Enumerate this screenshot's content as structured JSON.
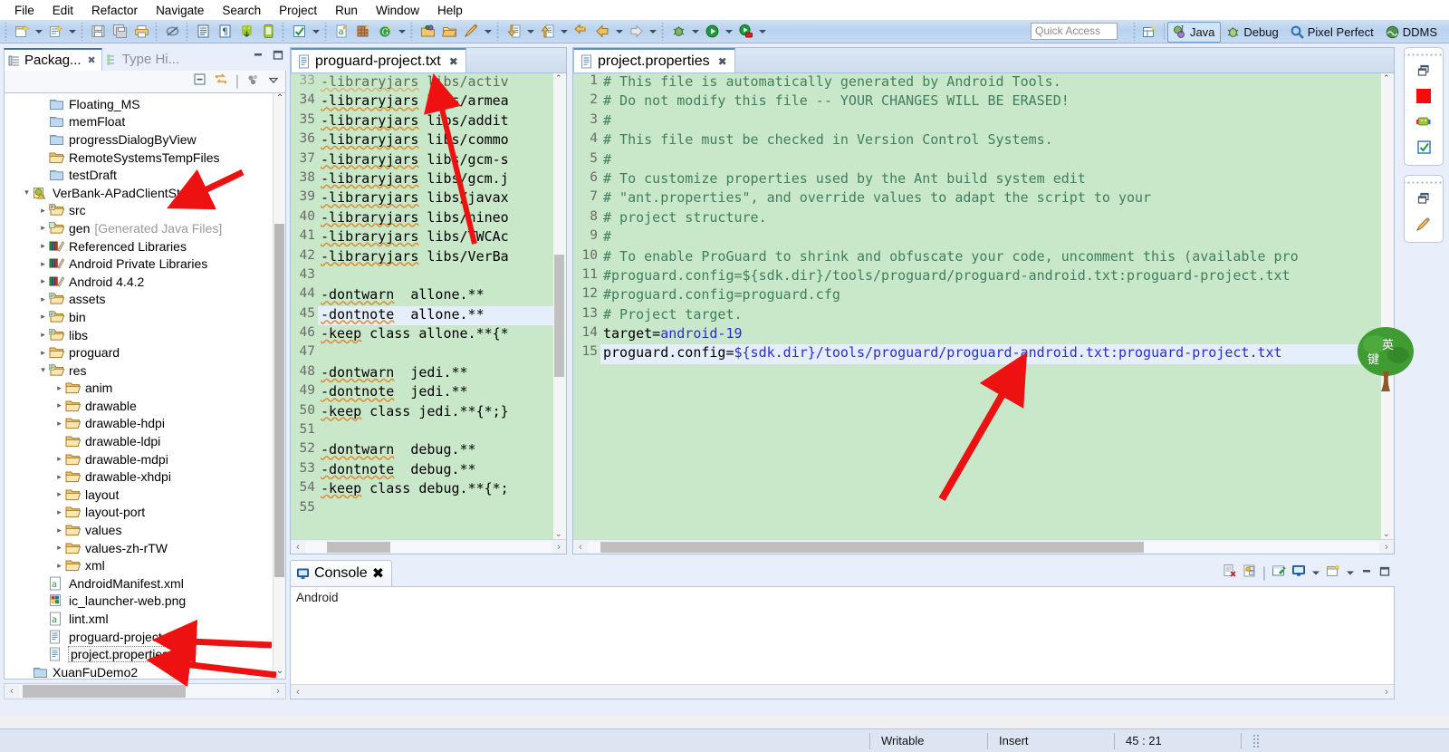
{
  "menubar": {
    "items": [
      "File",
      "Edit",
      "Refactor",
      "Navigate",
      "Search",
      "Project",
      "Run",
      "Window",
      "Help"
    ]
  },
  "toolbar": {
    "quick_access_placeholder": "Quick Access",
    "perspectives": [
      {
        "label": "Java",
        "icon": "java-perspective-icon",
        "active": true
      },
      {
        "label": "Debug",
        "icon": "debug-perspective-icon",
        "active": false
      },
      {
        "label": "Pixel Perfect",
        "icon": "pixel-perfect-icon",
        "active": false
      },
      {
        "label": "DDMS",
        "icon": "ddms-icon",
        "active": false
      }
    ],
    "buttons": [
      "new-wizard-icon",
      "new-java-class-icon",
      "save-icon",
      "save-all-icon",
      "print-icon",
      "toggle-breakpoint-icon",
      "open-task-icon",
      "show-whitespace-icon",
      "android-sdk-manager-icon",
      "android-avd-manager-icon",
      "check-icon",
      "new-android-xml-icon",
      "new-android-project-icon",
      "gwt-icon",
      "open-type-icon",
      "open-resource-icon",
      "pencil-icon",
      "debug-icon",
      "run-icon",
      "run-external-icon",
      "next-annotation-icon",
      "previous-annotation-icon",
      "last-edit-icon",
      "back-icon",
      "forward-icon"
    ]
  },
  "package_explorer": {
    "tabs": [
      {
        "label": "Packag...",
        "icon": "package-explorer-icon",
        "active": true
      },
      {
        "label": "Type Hi...",
        "icon": "type-hierarchy-icon",
        "active": false
      }
    ],
    "view_actions": [
      "collapse-all-icon",
      "link-with-editor-icon",
      "focus-icon",
      "view-menu-icon"
    ],
    "tree": [
      {
        "indent": 1,
        "twisty": "",
        "icon": "folder-closed-icon",
        "label": "Floating_MS"
      },
      {
        "indent": 1,
        "twisty": "",
        "icon": "folder-closed-icon",
        "label": "memFloat"
      },
      {
        "indent": 1,
        "twisty": "",
        "icon": "folder-closed-icon",
        "label": "progressDialogByView"
      },
      {
        "indent": 1,
        "twisty": "",
        "icon": "folder-open-icon",
        "label": "RemoteSystemsTempFiles"
      },
      {
        "indent": 1,
        "twisty": "",
        "icon": "folder-closed-icon",
        "label": "testDraft"
      },
      {
        "indent": 0,
        "twisty": "▾",
        "icon": "android-project-icon",
        "label": "VerBank-APadClientStation"
      },
      {
        "indent": 1,
        "twisty": "▸",
        "icon": "source-folder-icon",
        "label": "src"
      },
      {
        "indent": 1,
        "twisty": "▸",
        "icon": "gen-folder-icon",
        "label": "gen",
        "dim": "[Generated Java Files]"
      },
      {
        "indent": 1,
        "twisty": "▸",
        "icon": "library-icon",
        "label": "Referenced Libraries"
      },
      {
        "indent": 1,
        "twisty": "▸",
        "icon": "library-icon",
        "label": "Android Private Libraries"
      },
      {
        "indent": 1,
        "twisty": "▸",
        "icon": "library-icon",
        "label": "Android 4.4.2"
      },
      {
        "indent": 1,
        "twisty": "▸",
        "icon": "res-folder-icon",
        "label": "assets"
      },
      {
        "indent": 1,
        "twisty": "▸",
        "icon": "res-folder-icon",
        "label": "bin"
      },
      {
        "indent": 1,
        "twisty": "▸",
        "icon": "res-folder-icon",
        "label": "libs"
      },
      {
        "indent": 1,
        "twisty": "▸",
        "icon": "folder-open-icon",
        "label": "proguard"
      },
      {
        "indent": 1,
        "twisty": "▾",
        "icon": "res-folder-icon",
        "label": "res"
      },
      {
        "indent": 2,
        "twisty": "▸",
        "icon": "folder-open-icon",
        "label": "anim"
      },
      {
        "indent": 2,
        "twisty": "▸",
        "icon": "folder-open-icon",
        "label": "drawable"
      },
      {
        "indent": 2,
        "twisty": "▸",
        "icon": "folder-open-icon",
        "label": "drawable-hdpi"
      },
      {
        "indent": 2,
        "twisty": "",
        "icon": "folder-open-icon",
        "label": "drawable-ldpi"
      },
      {
        "indent": 2,
        "twisty": "▸",
        "icon": "folder-open-icon",
        "label": "drawable-mdpi"
      },
      {
        "indent": 2,
        "twisty": "▸",
        "icon": "folder-open-icon",
        "label": "drawable-xhdpi"
      },
      {
        "indent": 2,
        "twisty": "▸",
        "icon": "folder-open-icon",
        "label": "layout"
      },
      {
        "indent": 2,
        "twisty": "▸",
        "icon": "folder-open-icon",
        "label": "layout-port"
      },
      {
        "indent": 2,
        "twisty": "▸",
        "icon": "folder-open-icon",
        "label": "values"
      },
      {
        "indent": 2,
        "twisty": "▸",
        "icon": "folder-open-icon",
        "label": "values-zh-rTW"
      },
      {
        "indent": 2,
        "twisty": "▸",
        "icon": "folder-open-icon",
        "label": "xml"
      },
      {
        "indent": 1,
        "twisty": "",
        "icon": "android-xml-file-icon",
        "label": "AndroidManifest.xml"
      },
      {
        "indent": 1,
        "twisty": "",
        "icon": "png-image-icon",
        "label": "ic_launcher-web.png"
      },
      {
        "indent": 1,
        "twisty": "",
        "icon": "android-xml-file-icon",
        "label": "lint.xml"
      },
      {
        "indent": 1,
        "twisty": "",
        "icon": "text-file-icon",
        "label": "proguard-project.txt"
      },
      {
        "indent": 1,
        "twisty": "",
        "icon": "text-file-icon",
        "label": "project.properties",
        "selected": true
      },
      {
        "indent": 0,
        "twisty": "",
        "icon": "folder-closed-icon",
        "label": "XuanFuDemo2"
      }
    ]
  },
  "editor_left": {
    "tab": {
      "label": "proguard-project.txt",
      "icon": "text-file-icon",
      "close": "✖"
    },
    "lines": [
      {
        "n": "33",
        "text": "-libraryjars libs/activ",
        "clipped_top": true
      },
      {
        "n": "34",
        "text": "-libraryjars libs/armea"
      },
      {
        "n": "35",
        "text": "-libraryjars libs/addit"
      },
      {
        "n": "36",
        "text": "-libraryjars libs/commo"
      },
      {
        "n": "37",
        "text": "-libraryjars libs/gcm-s"
      },
      {
        "n": "38",
        "text": "-libraryjars libs/gcm.j"
      },
      {
        "n": "39",
        "text": "-libraryjars libs/javax"
      },
      {
        "n": "40",
        "text": "-libraryjars libs/nineo"
      },
      {
        "n": "41",
        "text": "-libraryjars libs/TWCAc"
      },
      {
        "n": "42",
        "text": "-libraryjars libs/VerBa"
      },
      {
        "n": "43",
        "text": ""
      },
      {
        "n": "44",
        "text": "-dontwarn  allone.**"
      },
      {
        "n": "45",
        "text": "-dontnote  allone.**",
        "caret": true
      },
      {
        "n": "46",
        "text": "-keep class allone.**{*"
      },
      {
        "n": "47",
        "text": ""
      },
      {
        "n": "48",
        "text": "-dontwarn  jedi.**"
      },
      {
        "n": "49",
        "text": "-dontnote  jedi.**"
      },
      {
        "n": "50",
        "text": "-keep class jedi.**{*;}"
      },
      {
        "n": "51",
        "text": ""
      },
      {
        "n": "52",
        "text": "-dontwarn  debug.**"
      },
      {
        "n": "53",
        "text": "-dontnote  debug.**"
      },
      {
        "n": "54",
        "text": "-keep class debug.**{*;"
      },
      {
        "n": "55",
        "text": ""
      }
    ]
  },
  "editor_right": {
    "tab": {
      "label": "project.properties",
      "icon": "text-file-icon",
      "close": "✖"
    },
    "lines": [
      {
        "n": "1",
        "text": "# This file is automatically generated by Android Tools.",
        "kind": "comment"
      },
      {
        "n": "2",
        "text": "# Do not modify this file -- YOUR CHANGES WILL BE ERASED!",
        "kind": "comment"
      },
      {
        "n": "3",
        "text": "#",
        "kind": "comment"
      },
      {
        "n": "4",
        "text": "# This file must be checked in Version Control Systems.",
        "kind": "comment"
      },
      {
        "n": "5",
        "text": "#",
        "kind": "comment"
      },
      {
        "n": "6",
        "text": "# To customize properties used by the Ant build system edit",
        "kind": "comment"
      },
      {
        "n": "7",
        "text": "# \"ant.properties\", and override values to adapt the script to your",
        "kind": "comment"
      },
      {
        "n": "8",
        "text": "# project structure.",
        "kind": "comment"
      },
      {
        "n": "9",
        "text": "#",
        "kind": "comment"
      },
      {
        "n": "10",
        "text": "# To enable ProGuard to shrink and obfuscate your code, uncomment this (available pro",
        "kind": "comment"
      },
      {
        "n": "11",
        "text": "#proguard.config=${sdk.dir}/tools/proguard/proguard-android.txt:proguard-project.txt",
        "kind": "comment"
      },
      {
        "n": "12",
        "text": "#proguard.config=proguard.cfg",
        "kind": "comment"
      },
      {
        "n": "13",
        "text": "# Project target.",
        "kind": "comment"
      },
      {
        "n": "14",
        "text": "target=android-19",
        "kind": "property",
        "key": "target=",
        "value": "android-19"
      },
      {
        "n": "15",
        "text": "proguard.config=${sdk.dir}/tools/proguard/proguard-android.txt:proguard-project.txt",
        "kind": "property",
        "key": "proguard.config=",
        "value": "${sdk.dir}/tools/proguard/proguard-android.txt:proguard-project.txt",
        "highlighted": true
      }
    ]
  },
  "console": {
    "tab": {
      "label": "Console",
      "icon": "console-icon",
      "close": "✖"
    },
    "stream_label": "Android",
    "tools": [
      "clear-console-icon",
      "scroll-lock-icon",
      "pin-console-icon",
      "display-selected-console-icon",
      "console-dropdown-icon",
      "open-console-icon",
      "open-console-dropdown-icon",
      "minimize-icon",
      "maximize-icon"
    ]
  },
  "fastview": {
    "groups": [
      {
        "items": [
          "restore-icon",
          "red-square-icon",
          "logcat-icon",
          "checkbox-icon"
        ]
      },
      {
        "items": [
          "restore-icon",
          "pencil-icon"
        ]
      }
    ]
  },
  "statusbar": {
    "writable": "Writable",
    "insert_mode": "Insert",
    "cursor_position": "45 : 21"
  },
  "watermark": {
    "line1": "英",
    "line2": "键"
  },
  "colors": {
    "editor_background": "#c9e7c9",
    "selection": "#e5eefb",
    "accent": "#2b2bd8",
    "comment": "#3f7f5f",
    "arrow": "#ee1111",
    "toolbar": "#c6daf3",
    "statusbar": "#dde5f3"
  }
}
